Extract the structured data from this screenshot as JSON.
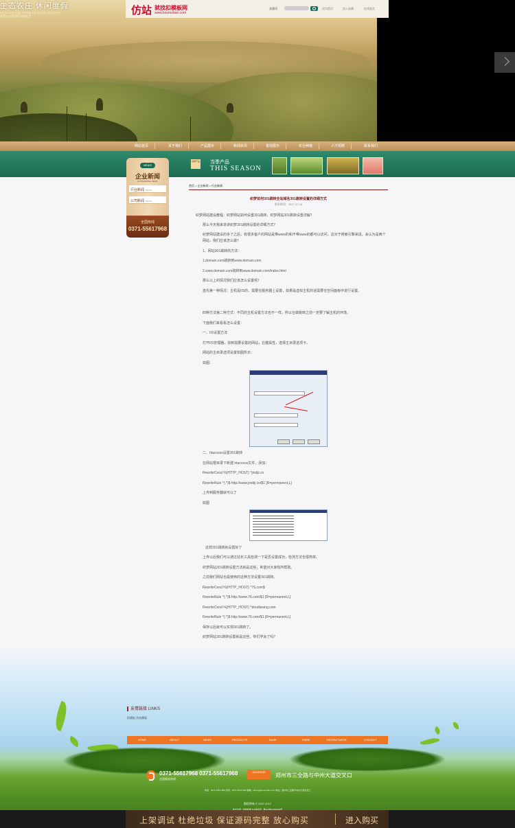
{
  "header": {
    "logo_main": "仿站",
    "logo_sub": "就找扣模板网",
    "logo_url": "www.koumoban.com",
    "search_label": "关键词",
    "search_placeholder": "",
    "top_links": [
      "设为首页",
      "加入收藏",
      "在线留言"
    ]
  },
  "hero": {
    "slogan": "生态农庄 休闲度假",
    "slogan_en": "ECOLOGICAL FARM LEISURE RESORT",
    "slogan_sub": "享受大自然 回归田园生活"
  },
  "nav": {
    "items": [
      {
        "label": "网站首页",
        "en": "HOME"
      },
      {
        "label": "关于我们",
        "en": "ABOUT"
      },
      {
        "label": "产品展示",
        "en": "PRODUCTS"
      },
      {
        "label": "新闻资讯",
        "en": "NEWS"
      },
      {
        "label": "基地展示",
        "en": "BASE"
      },
      {
        "label": "农业种植",
        "en": "FARM"
      },
      {
        "label": "人才招聘",
        "en": "RECRUITMENT"
      },
      {
        "label": "联系我们",
        "en": "CONTACT"
      }
    ]
  },
  "season": {
    "badge": "当季产品",
    "title_cn": "当季产品",
    "title_en": "THIS SEASON"
  },
  "sidebar": {
    "ring_label": "NEWS",
    "title": "企业新闻",
    "title_en": "ENTERPRISE NEWS",
    "items": [
      {
        "label": "行业新闻",
        "sub": "NEWS"
      },
      {
        "label": "公司新闻",
        "sub": "NEWS"
      }
    ],
    "tel_label": "全国热线",
    "tel": "0371-55617968"
  },
  "article": {
    "breadcrumb": "首页 > 企业新闻 > 行业新闻",
    "title": "织梦如何301跳转全站域名301跳转设置的详细方式",
    "meta": "发布时间：2017-12-18",
    "paragraphs": [
      "织梦网站建设教程：织梦网站如何设置301跳转，织梦网站301跳转设置详解？",
      "那么今天我来讲讲织梦301跳转设置的详细方式？",
      "织梦网站建设的多了之后，有很多客户的网站是带www的和不带www的都可以访问，这对于搜索引擎来说，会认为是两个网站，我们应该怎么做？",
      "1、网站301跳转的方法：",
      "1.domain.com跳转到www.domain.com",
      "2.www.domain.com跳转到www.domain.com/index.html",
      "那么以上的情况我们应该怎么设置呢？",
      "首先第一种情况：主机是IIS的，需要在服务器上设置，如果是虚拟主机的话需要在空间面板中进行设置。",
      "四种方法第二种方式：不同的主机设置方法也不一样，所以在做跳转之前一定要了解主机的环境。",
      "下面我们来看看怎么设置：",
      "一、IIS设置方法",
      "打开IIS管理器，找到需要设置的网站，右键属性，选择主目录选项卡。",
      "网站的主目录选项设置如图所示：",
      "如图：",
      "二、htaccess设置301跳转",
      "在网站根目录下新建.htaccess文件，添加：",
      "RewriteCond %{HTTP_HOST} ^jindiji.cn",
      "RewriteRule ^(.*)$ http://www.jindiji.cn/$1 [R=permanent,L]",
      "上传到服务器就可以了",
      "如图",
      "这样301跳转就设置好了",
      "上传以后我们可以通过站长工具检测一下是否设置成功，检测方法也很简单。",
      "织梦网站301跳转设置方法就是这些，希望对大家有所帮助。",
      "之前我们网站也是使用的这种方法设置301跳转。",
      "RewriteCond %{HTTP_HOST} ^76.com$",
      "RewriteRule ^(.*)$ http://www.76.com/$1 [R=permanent,L]",
      "RewriteCond %{HTTP_HOST} ^doudiwang.com",
      "RewriteRule ^(.*)$ http://www.76.com/$1 [R=permanent,L]",
      "保存以后就可以实现301跳转了。",
      "织梦网站301跳转设置就是这些，你们学会了吗？"
    ]
  },
  "footer": {
    "links_title": "友情链接  LINKS",
    "links": [
      "扣模板  仿站模板"
    ],
    "nav": [
      "HOME",
      "ABOUT",
      "NEWS",
      "PRODUCTS",
      "BASE",
      "FARM",
      "RECRUITMENT",
      "CONTACT"
    ],
    "phone": "0371-55617968  0371-55617968",
    "hours": "全国服务热线",
    "address_badge": "ADDRESS",
    "address": "郑州市三全路与中州大道交叉口",
    "small_text": "电话：0371-55617968  传真：0371-55617968  邮箱：admin@koumoban.com  地址：郑州市三全路与中州大道交叉口",
    "copyright": "版权所有 © 2007-2017",
    "icp": "技术支持：扣模板网  ICP备案号：豫ICP备12345678号"
  },
  "promo": {
    "text": "上架调试  杜绝垃圾  保证源码完整  放心购买",
    "buy": "进入购买"
  },
  "colors": {
    "nav_bg": "#c79a63",
    "season_bg": "#1f7156",
    "accent_orange": "#ee7622",
    "title_red": "#7a1c1c"
  }
}
